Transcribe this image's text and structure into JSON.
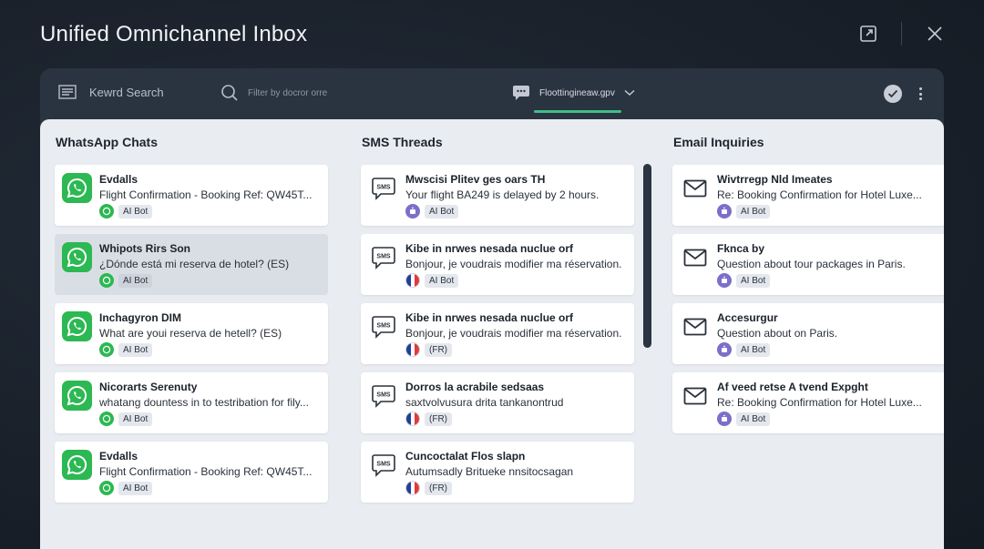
{
  "app": {
    "title": "Unified Omnichannel Inbox"
  },
  "toolbar": {
    "keyword_search": "Kewrd Search",
    "filter_placeholder": "Filter by docror orre",
    "channel_selector": "Floottingineaw.gpv"
  },
  "colors": {
    "whatsapp": "#2cb852",
    "accent": "#3fbf88",
    "bot": "#7b6fc9",
    "france_blue": "#1f3f9a",
    "france_red": "#e03a3e"
  },
  "columns": {
    "whatsapp": {
      "title": "WhatsApp Chats",
      "icon": "whatsapp-icon",
      "items": [
        {
          "name": "Evdalls",
          "preview": "Flight Confirmation - Booking Ref: QW45T...",
          "tag": "AI Bot",
          "selected": false
        },
        {
          "name": "Whipots Rirs Son",
          "preview": "¿Dónde está mi reserva de hotel? (ES)",
          "tag": "AI Bot",
          "selected": true
        },
        {
          "name": "Inchagyron DIM",
          "preview": "What are youi reserva de hetell? (ES)",
          "tag": "AI Bot",
          "selected": false
        },
        {
          "name": "Nicorarts Serenuty",
          "preview": "whatang dountess in to testribation for fily...",
          "tag": "AI Bot",
          "selected": false
        },
        {
          "name": "Evdalls",
          "preview": "Flight Confirmation - Booking Ref: QW45T...",
          "tag": "AI Bot",
          "selected": false
        }
      ]
    },
    "sms": {
      "title": "SMS Threads",
      "icon": "sms-icon",
      "icon_text": "SMS",
      "items": [
        {
          "name": "Mwscisi Plitev ges oars TH",
          "preview": "Your flight BA249 is delayed by 2 hours.",
          "tag": "AI Bot",
          "badge": "bot"
        },
        {
          "name": "Kibe in nrwes nesada nuclue orf",
          "preview": "Bonjour, je voudrais modifier ma réservation.",
          "tag": "AI Bot",
          "badge": "flag"
        },
        {
          "name": "Kibe in nrwes nesada nuclue orf",
          "preview": "Bonjour, je voudrais modifier ma réservation.",
          "tag": "(FR)",
          "badge": "flag"
        },
        {
          "name": "Dorros la acrabile sedsaas",
          "preview": "saxtvolvusura drita tankanontrud",
          "tag": "(FR)",
          "badge": "flag"
        },
        {
          "name": "Cuncoctalat Flos slapn",
          "preview": "Autumsadly Britueke nnsitocsagan",
          "tag": "(FR)",
          "badge": "flag"
        }
      ]
    },
    "email": {
      "title": "Email Inquiries",
      "icon": "mail-icon",
      "items": [
        {
          "name": "Wivtrregp Nld Imeates",
          "preview": "Re: Booking Confirmation for Hotel Luxe...",
          "tag": "AI Bot"
        },
        {
          "name": "Fknca by",
          "preview": "Question about tour packages in Paris.",
          "tag": "AI Bot"
        },
        {
          "name": "Accesurgur",
          "preview": "Question about on Paris.",
          "tag": "AI Bot"
        },
        {
          "name": "Af veed retse A tvend Expght",
          "preview": "Re: Booking Confirmation for Hotel Luxe...",
          "tag": "AI Bot"
        }
      ]
    }
  }
}
